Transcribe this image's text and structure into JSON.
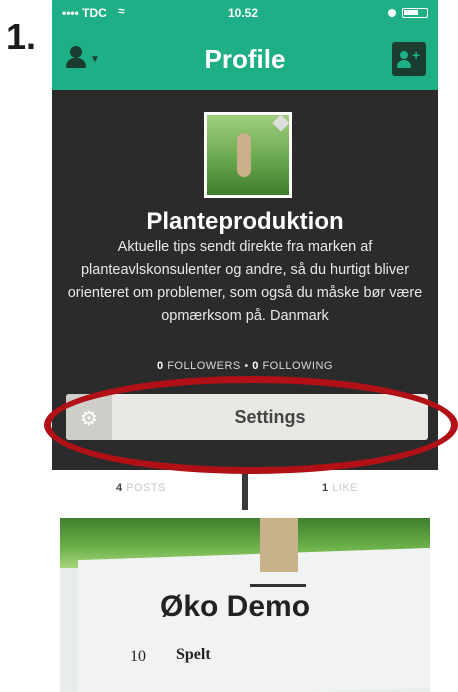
{
  "step": {
    "number": "1."
  },
  "status_bar": {
    "carrier": "•••• TDC",
    "time": "10.52"
  },
  "nav": {
    "title": "Profile"
  },
  "profile": {
    "name": "Planteproduktion",
    "description": "Aktuelle tips sendt direkte fra marken af planteavlskonsulenter og andre, så du hurtigt bliver orienteret om problemer, som også du måske bør være opmærksom på. Danmark",
    "followers_count": "0",
    "followers_label": "FOLLOWERS",
    "following_count": "0",
    "following_label": "FOLLOWING",
    "separator": "•"
  },
  "settings": {
    "label": "Settings"
  },
  "tabs": {
    "posts": {
      "count": "4",
      "label": "POSTS"
    },
    "likes": {
      "count": "1",
      "label": "LIKE"
    }
  },
  "post": {
    "sign_title": "Øko Demo",
    "sign_number": "10",
    "sign_crop": "Spelt"
  },
  "colors": {
    "accent": "#1faf86",
    "dark": "#2b2b2b",
    "highlight": "#b01016"
  },
  "icons": {
    "nav_left": "user-menu-icon",
    "nav_right": "add-friend-icon",
    "settings": "gear-icon",
    "wifi": "wifi-icon",
    "battery": "battery-icon"
  }
}
